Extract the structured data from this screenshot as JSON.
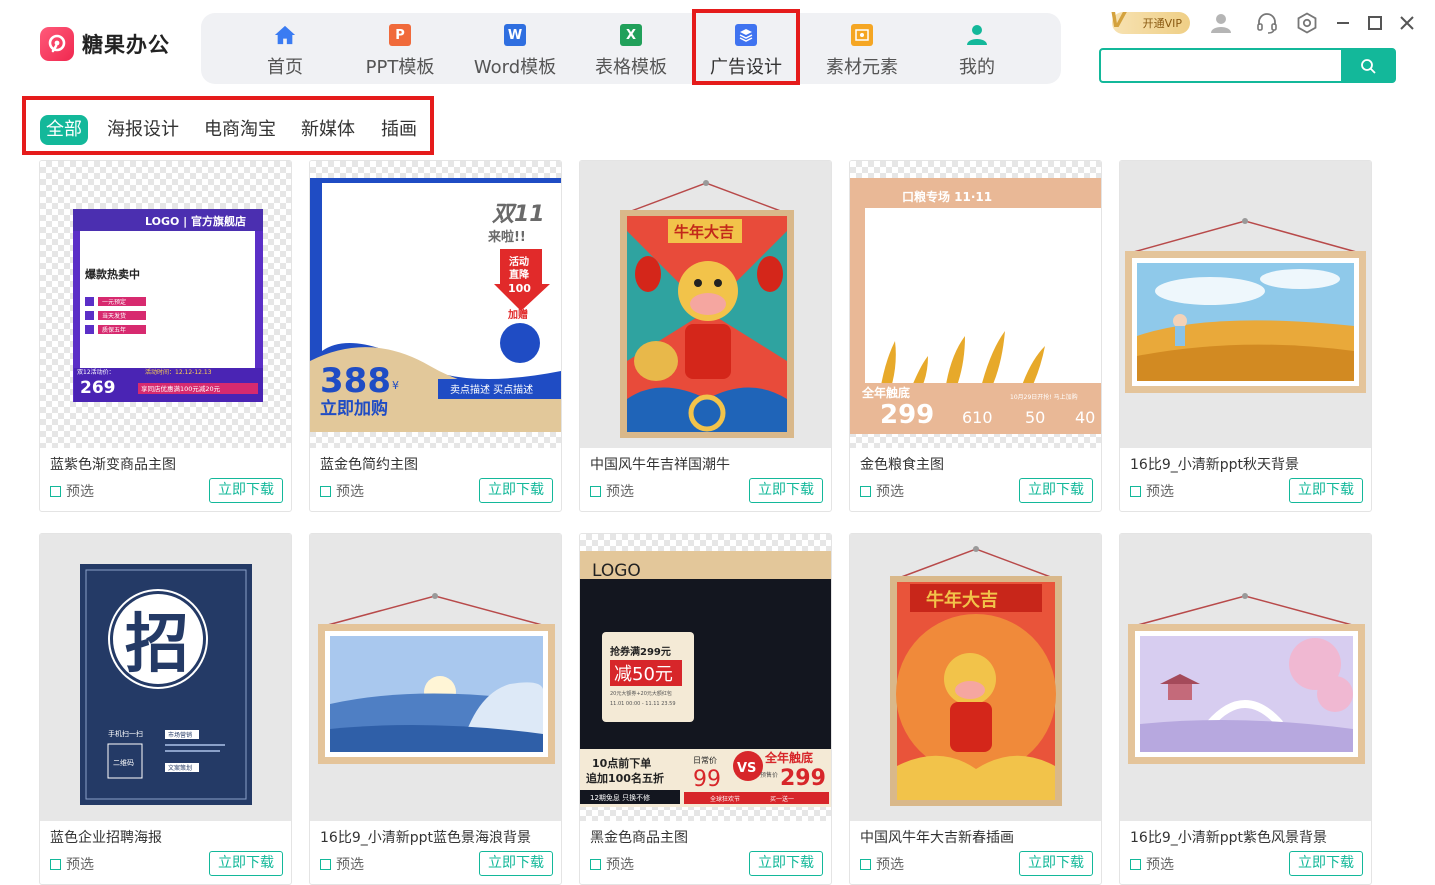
{
  "app": {
    "name": "糖果办公"
  },
  "nav": [
    {
      "label": "首页",
      "icon": "home-icon",
      "color": "#3a7bf2"
    },
    {
      "label": "PPT模板",
      "icon": "ppt-icon",
      "color": "#f06a3b",
      "glyph": "P"
    },
    {
      "label": "Word模板",
      "icon": "word-icon",
      "color": "#2f6fe0",
      "glyph": "W"
    },
    {
      "label": "表格模板",
      "icon": "excel-icon",
      "color": "#21a05a",
      "glyph": "X"
    },
    {
      "label": "广告设计",
      "icon": "ad-design-icon",
      "color": "#3f73f0"
    },
    {
      "label": "素材元素",
      "icon": "material-icon",
      "color": "#f5a623"
    },
    {
      "label": "我的",
      "icon": "user-icon",
      "color": "#13b89a"
    }
  ],
  "active_nav": "广告设计",
  "toolbar": {
    "vip_label": "开通VIP"
  },
  "search": {
    "placeholder": "",
    "value": ""
  },
  "categories": [
    "全部",
    "海报设计",
    "电商淘宝",
    "新媒体",
    "插画"
  ],
  "active_category": "全部",
  "card_labels": {
    "preview": "预选",
    "download": "立即下载"
  },
  "cards": [
    {
      "title": "蓝紫色渐变商品主图",
      "thumb_style": "checker"
    },
    {
      "title": "蓝金色简约主图",
      "thumb_style": "checker"
    },
    {
      "title": "中国风牛年吉祥国潮牛",
      "thumb_style": "grey"
    },
    {
      "title": "金色粮食主图",
      "thumb_style": "checker"
    },
    {
      "title": "16比9_小清新ppt秋天背景",
      "thumb_style": "grey"
    },
    {
      "title": "蓝色企业招聘海报",
      "thumb_style": "grey"
    },
    {
      "title": "16比9_小清新ppt蓝色景海浪背景",
      "thumb_style": "grey"
    },
    {
      "title": "黑金色商品主图",
      "thumb_style": "checker"
    },
    {
      "title": "中国风牛年大吉新春插画",
      "thumb_style": "grey"
    },
    {
      "title": "16比9_小清新ppt紫色风景背景",
      "thumb_style": "grey"
    }
  ],
  "thumb_text": {
    "c1": {
      "logo": "LOGO | 官方旗舰店",
      "headline": "爆款热卖中",
      "items": [
        "一元预定",
        "当天发货",
        "质保五年"
      ],
      "date": "活动时间：12.12-12.13",
      "price": "269",
      "promo": "享同店优惠满100元减20元",
      "tag": "双12活动价："
    },
    "c2": {
      "big": "双11",
      "sub": "来啦!!",
      "ribbon": [
        "活动",
        "直降",
        "100"
      ],
      "gift": "加赠",
      "price": "388",
      "yen": "¥",
      "cta": "立即加购",
      "desc": "卖点描述 买点描述"
    },
    "c3": {
      "banner": "牛年大吉"
    },
    "c4": {
      "header": "口粮专场 11·11",
      "tag": "全年触底",
      "price": "299",
      "note": "10月29日开抢! 马上加购",
      "p1": "610",
      "p2": "50",
      "p3": "40"
    },
    "c6": {
      "big": "招",
      "scan": "手机扫一扫",
      "qr": "二维码",
      "job1": "市场营销",
      "job2": "文案策划"
    },
    "c8": {
      "logo": "LOGO",
      "coupon": "抢券满299元",
      "minus": "减50元",
      "c1": "20元大额券+20元大额红包",
      "c2": "11.01 00:00 - 11.11 23.59",
      "tip1": "10点前下单",
      "tip2": "追加100名五折",
      "tip3": "12期免息 只换不修",
      "daily": "日常价",
      "p1": "99",
      "vs": "VS",
      "low": "全年触底",
      "pre": "预售价",
      "p2": "299",
      "tip4": "全球狂欢节",
      "tip5": "买一送一"
    },
    "c9": {
      "banner": "牛年大吉"
    }
  }
}
